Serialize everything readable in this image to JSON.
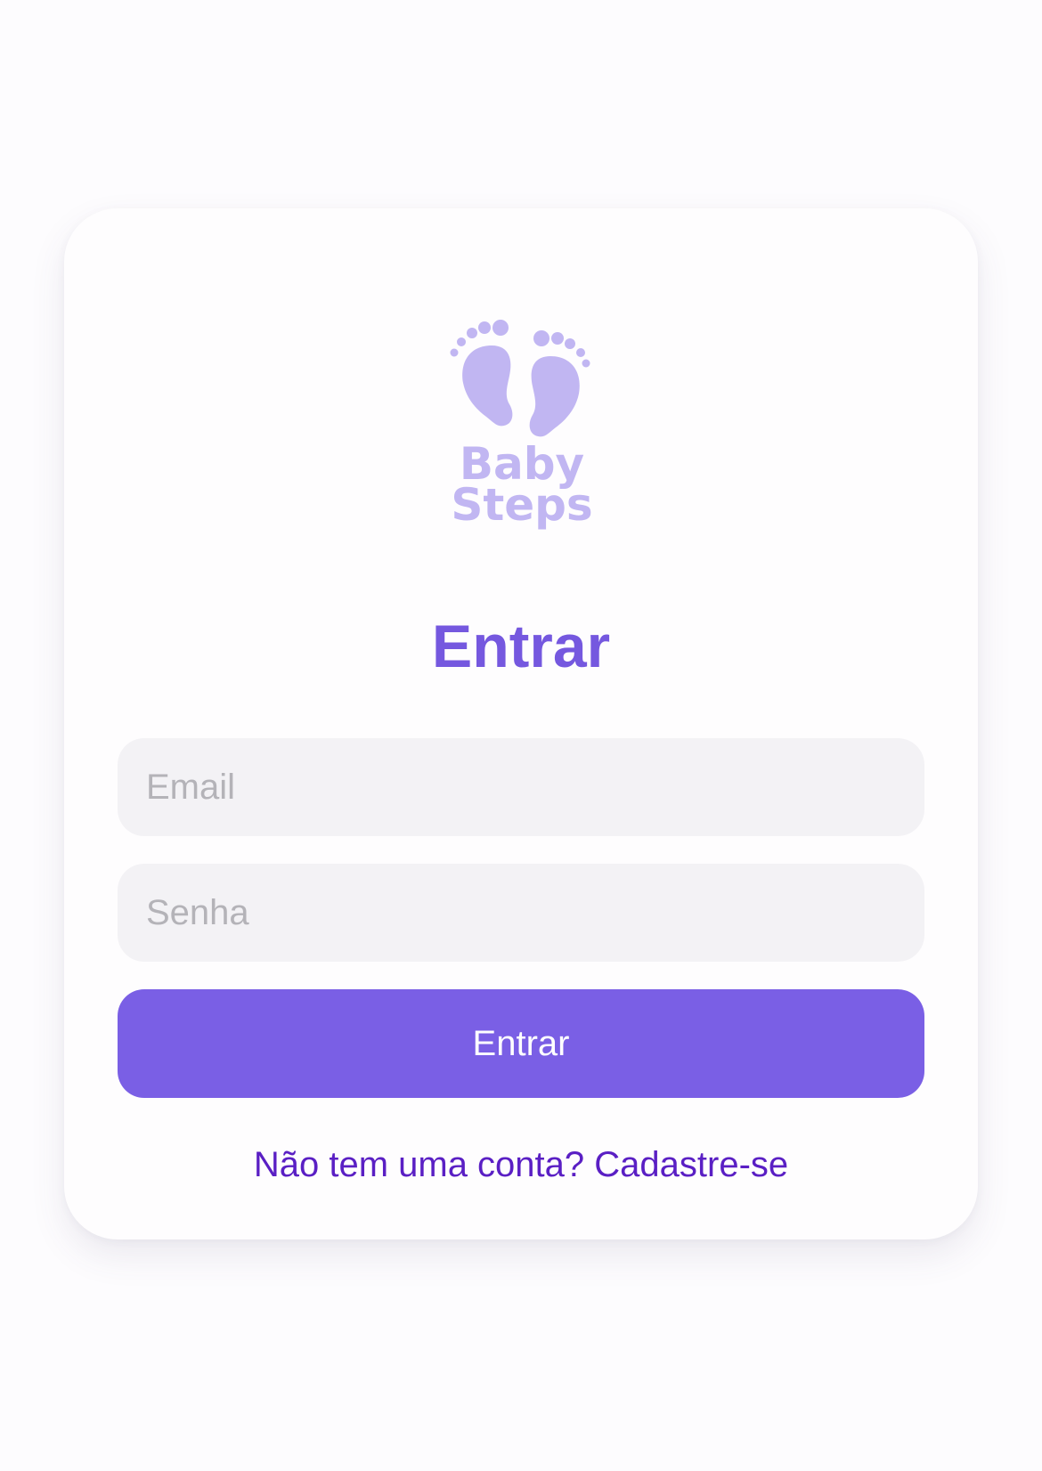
{
  "brand": {
    "logo_text_line1": "Baby",
    "logo_text_line2": "Steps",
    "logo_icon": "baby-feet-icon",
    "logo_color": "#c1b6f2"
  },
  "login": {
    "title": "Entrar",
    "email_placeholder": "Email",
    "password_placeholder": "Senha",
    "submit_label": "Entrar",
    "signup_link": "Não tem uma conta? Cadastre-se"
  },
  "colors": {
    "accent": "#7a5fe5",
    "title": "#7558df",
    "link": "#5a1fc4",
    "field_background": "#f3f2f5",
    "background": "#fdfcfe"
  }
}
